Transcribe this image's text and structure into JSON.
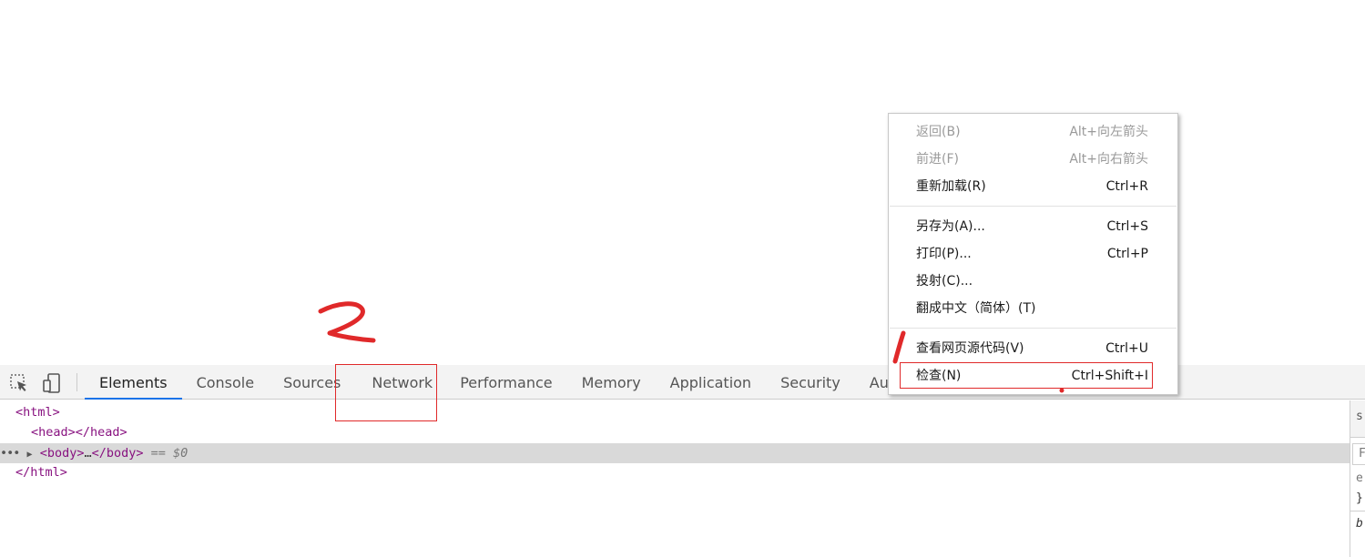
{
  "toolbar": {
    "tabs": [
      {
        "label": "Elements",
        "active": true
      },
      {
        "label": "Console"
      },
      {
        "label": "Sources"
      },
      {
        "label": "Network"
      },
      {
        "label": "Performance"
      },
      {
        "label": "Memory"
      },
      {
        "label": "Application"
      },
      {
        "label": "Security"
      },
      {
        "label": "Audits"
      }
    ]
  },
  "dom": {
    "html_open": "<html>",
    "head": "<head></head>",
    "body_open": "<body>",
    "body_ellipsis": "…",
    "body_close": "</body>",
    "selected_marker": "== $0",
    "html_close": "</html>"
  },
  "context_menu": {
    "items": [
      {
        "label": "返回(B)",
        "shortcut": "Alt+向左箭头"
      },
      {
        "label": "前进(F)",
        "shortcut": "Alt+向右箭头"
      },
      {
        "label": "重新加载(R)",
        "shortcut": "Ctrl+R"
      },
      {
        "label": "另存为(A)...",
        "shortcut": "Ctrl+S"
      },
      {
        "label": "打印(P)...",
        "shortcut": "Ctrl+P"
      },
      {
        "label": "投射(C)...",
        "shortcut": ""
      },
      {
        "label": "翻成中文（简体）(T)",
        "shortcut": ""
      },
      {
        "label": "查看网页源代码(V)",
        "shortcut": "Ctrl+U"
      },
      {
        "label": "检查(N)",
        "shortcut": "Ctrl+Shift+I"
      }
    ]
  },
  "right_panel": {
    "fragments": [
      "s",
      "F",
      "e",
      "}",
      "b"
    ]
  },
  "colors": {
    "annotation": "#e0292a",
    "active_tab_underline": "#1a73e8",
    "tag": "#881280"
  },
  "icons": [
    "inspect-element-icon",
    "device-toolbar-icon",
    "expand-triangle-icon"
  ]
}
